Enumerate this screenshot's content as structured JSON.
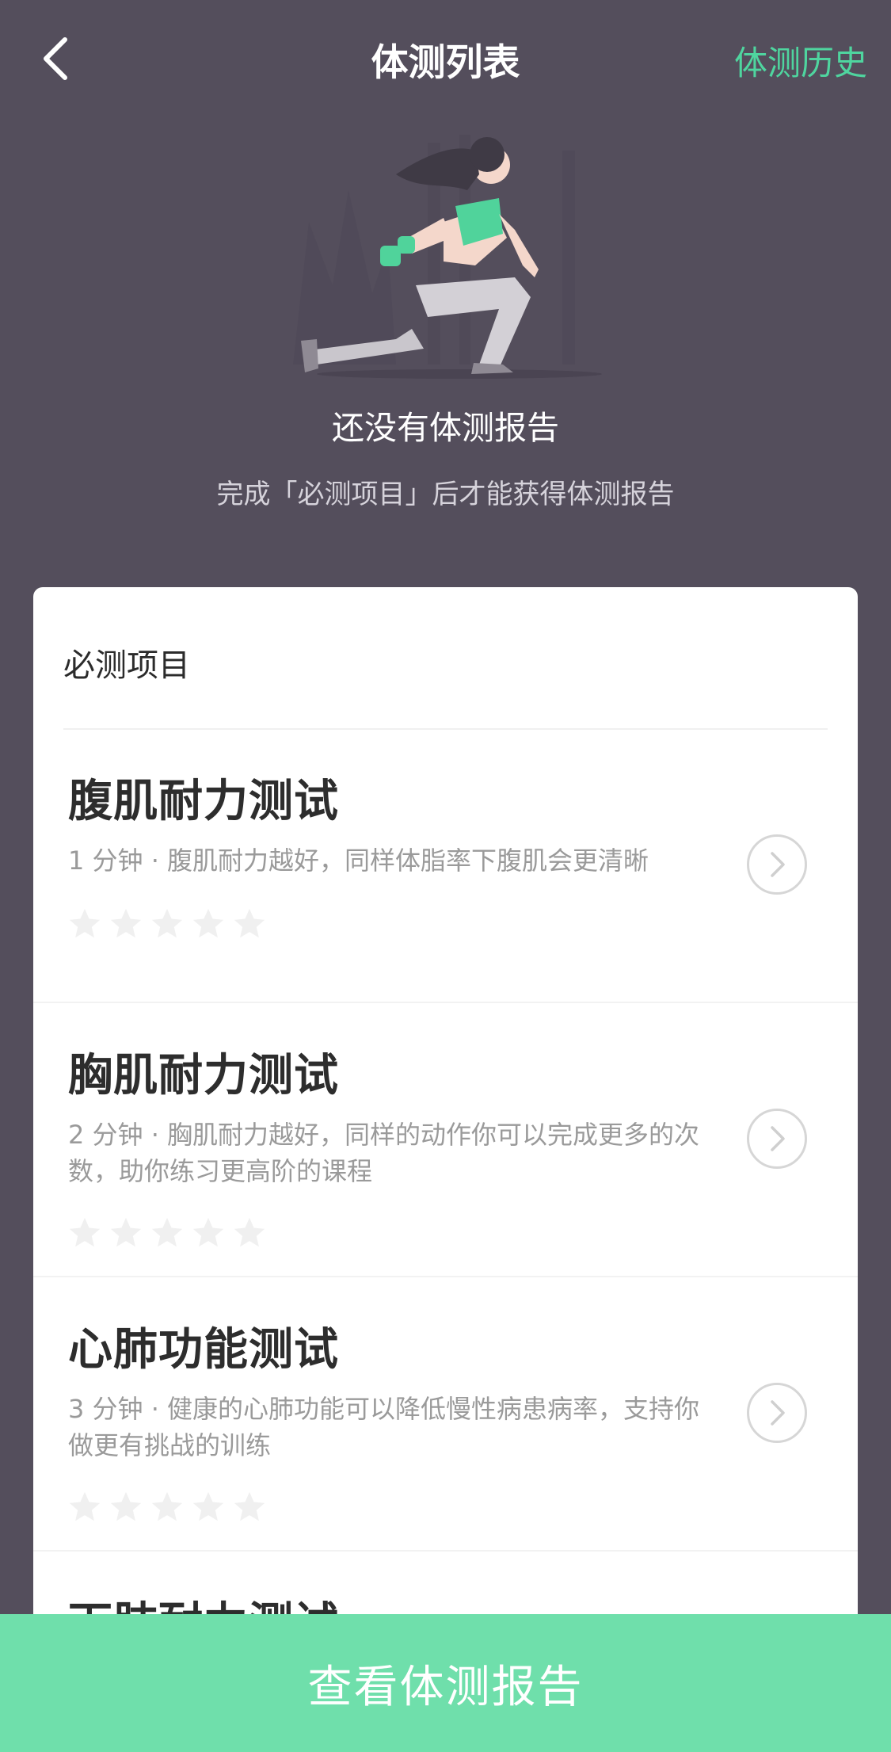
{
  "nav": {
    "title": "体测列表",
    "right_label": "体测历史"
  },
  "hero": {
    "title": "还没有体测报告",
    "subtitle": "完成「必测项目」后才能获得体测报告"
  },
  "card": {
    "header": "必测项目",
    "items": [
      {
        "title": "腹肌耐力测试",
        "desc": "1 分钟 · 腹肌耐力越好，同样体脂率下腹肌会更清晰",
        "stars": 0
      },
      {
        "title": "胸肌耐力测试",
        "desc": "2 分钟 · 胸肌耐力越好，同样的动作你可以完成更多的次数，助你练习更高阶的课程",
        "stars": 0
      },
      {
        "title": "心肺功能测试",
        "desc": "3 分钟 · 健康的心肺功能可以降低慢性病患病率，支持你做更有挑战的训练",
        "stars": 0
      },
      {
        "title": "下肢耐力测试",
        "desc": "",
        "stars": 0
      }
    ]
  },
  "bottom_button": {
    "label": "查看体测报告"
  },
  "colors": {
    "background": "#544e5c",
    "accent": "#4fd59f",
    "button": "#6fdfab"
  }
}
